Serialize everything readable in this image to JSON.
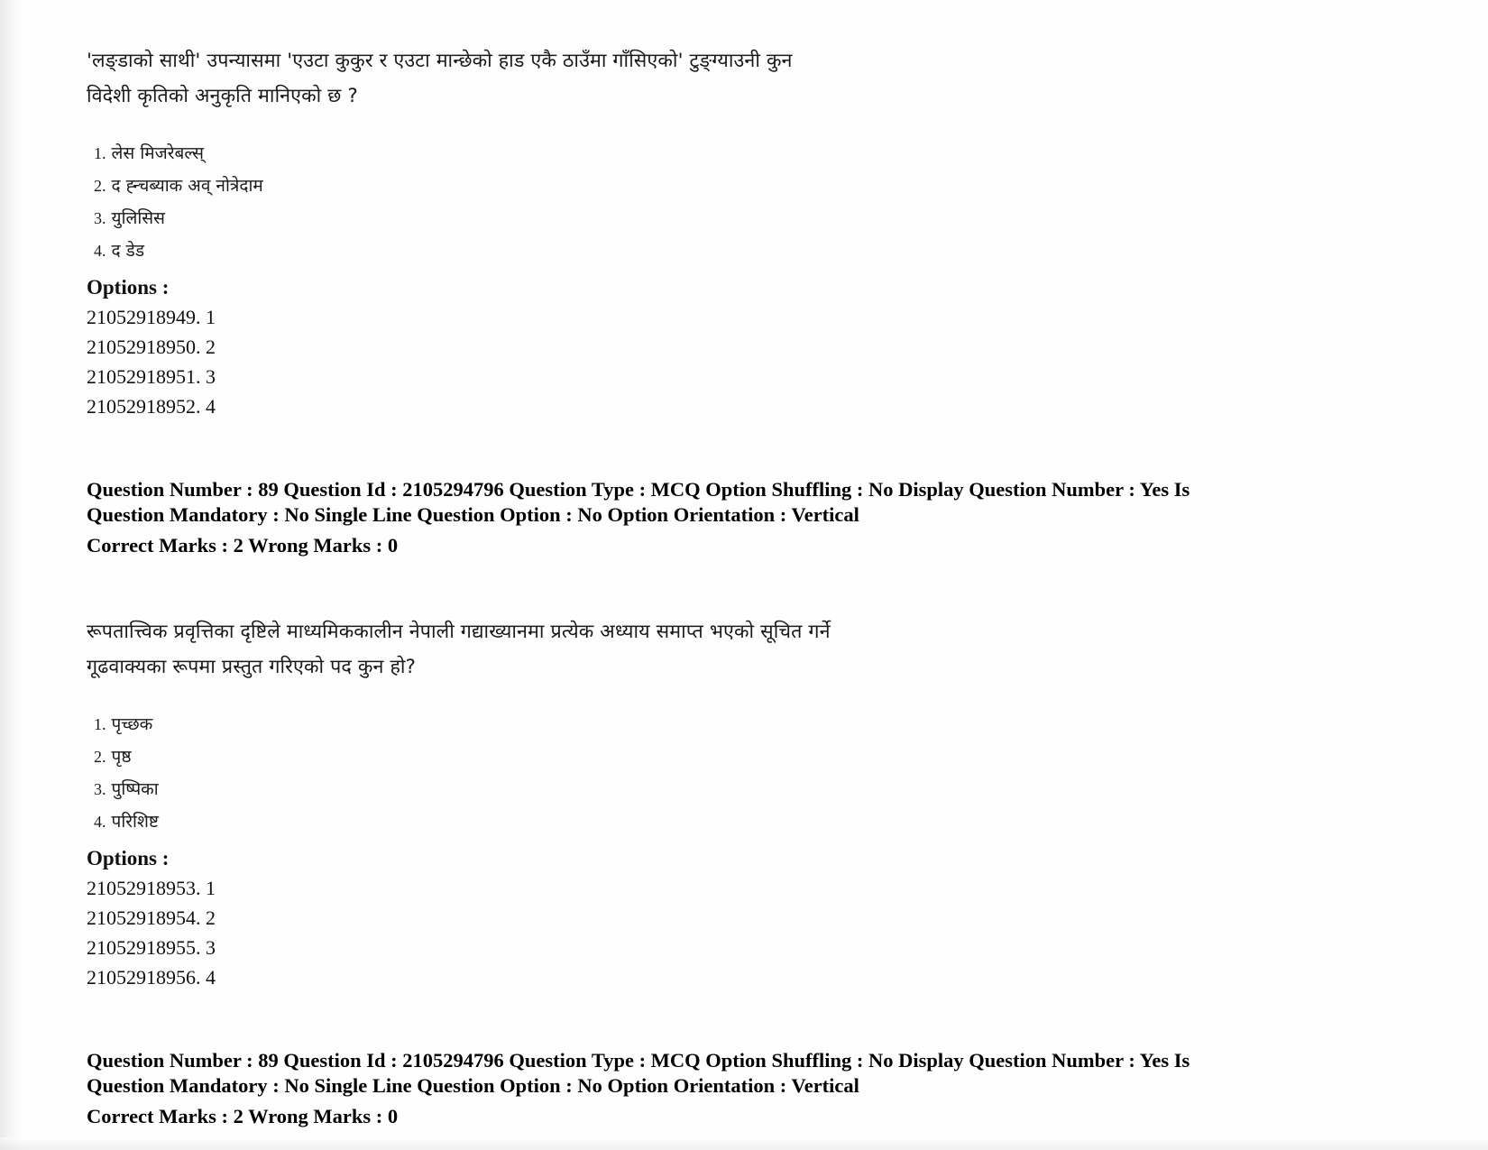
{
  "document": {
    "type": "exam-question-paper-scan",
    "page_background": "#ffffff"
  },
  "questions": [
    {
      "stem_lines": [
        "'लङ्डाको साथी' उपन्यासमा 'एउटा कुकुर र एउटा मान्छेको हाड एकै ठाउँमा गाँसिएको' टुङ्ग्याउनी कुन",
        "विदेशी कृतिको अनुकृति मानिएको छ ?"
      ],
      "choices": [
        {
          "num": "1.",
          "text": "लेस मिजरेबल्स्"
        },
        {
          "num": "2.",
          "text": "द ह्न्चब्याक अव् नोत्रेदाम"
        },
        {
          "num": "3.",
          "text": "युलिसिस"
        },
        {
          "num": "4.",
          "text": "द डेड"
        }
      ],
      "options_label": "Options :",
      "option_ids": [
        "21052918949. 1",
        "21052918950. 2",
        "21052918951. 3",
        "21052918952. 4"
      ],
      "meta_line_1": "Question Number : 89 Question Id : 2105294796 Question Type : MCQ Option Shuffling : No Display Question Number : Yes Is",
      "meta_line_2": "Question Mandatory : No Single Line Question Option : No Option Orientation : Vertical",
      "meta_marks": "Correct Marks : 2 Wrong Marks : 0"
    },
    {
      "stem_lines": [
        "रूपतात्त्विक प्रवृत्तिका दृष्टिले माध्यमिककालीन नेपाली गद्याख्यानमा प्रत्येक अध्याय समाप्त भएको सूचित गर्ने",
        "गूढवाक्यका रूपमा प्रस्तुत गरिएको पद कुन हो?"
      ],
      "choices": [
        {
          "num": "1.",
          "text": "पृच्छक"
        },
        {
          "num": "2.",
          "text": "पृष्ठ"
        },
        {
          "num": "3.",
          "text": "पुष्पिका"
        },
        {
          "num": "4.",
          "text": "परिशिष्ट"
        }
      ],
      "options_label": "Options :",
      "option_ids": [
        "21052918953. 1",
        "21052918954. 2",
        "21052918955. 3",
        "21052918956. 4"
      ],
      "meta_line_1": "Question Number : 89 Question Id : 2105294796 Question Type : MCQ Option Shuffling : No Display Question Number : Yes Is",
      "meta_line_2": "Question Mandatory : No Single Line Question Option : No Option Orientation : Vertical",
      "meta_marks": "Correct Marks : 2 Wrong Marks : 0"
    }
  ]
}
